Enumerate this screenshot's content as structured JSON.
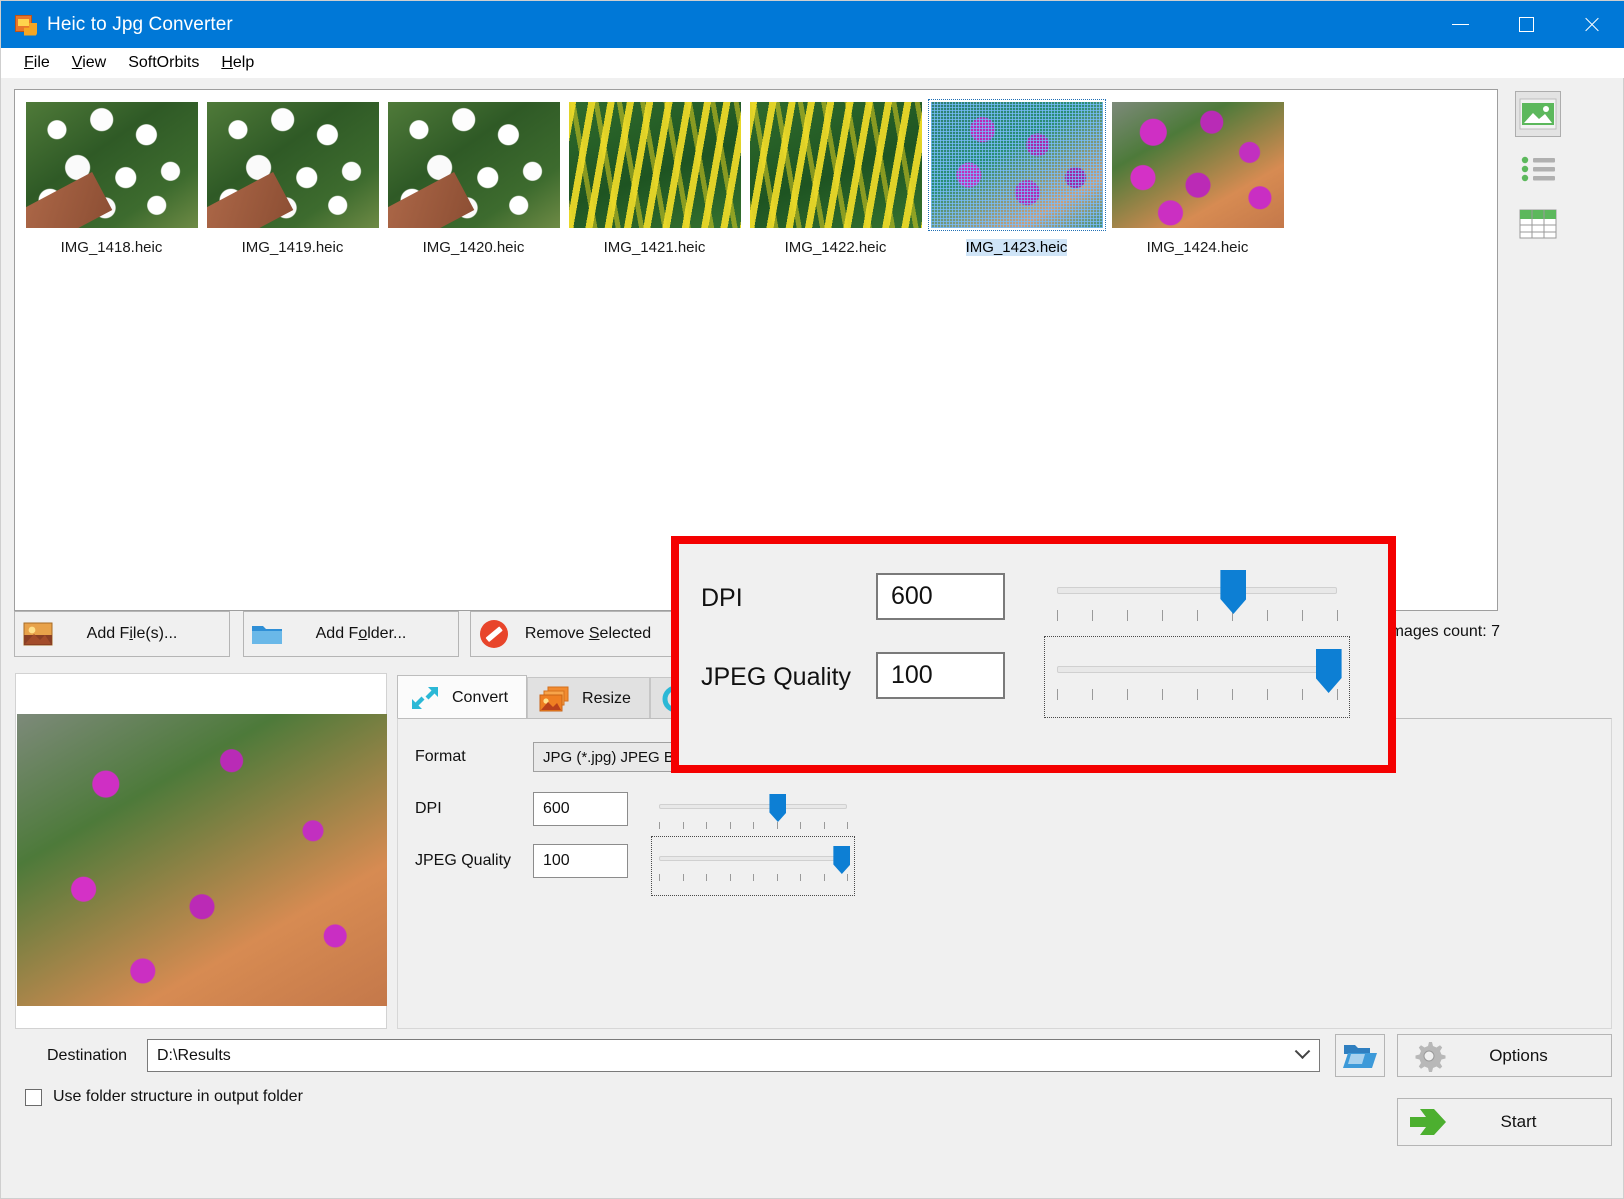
{
  "window": {
    "title": "Heic to Jpg Converter",
    "icon": "app-icon",
    "minimize": "minimize",
    "maximize": "maximize",
    "close": "close"
  },
  "menu": {
    "items": [
      {
        "label": "File",
        "accel": "F"
      },
      {
        "label": "View",
        "accel": "V"
      },
      {
        "label": "SoftOrbits",
        "accel": ""
      },
      {
        "label": "Help",
        "accel": "H"
      }
    ]
  },
  "thumbnails": {
    "items": [
      {
        "label": "IMG_1418.heic",
        "photo": "white-flowers",
        "selected": false
      },
      {
        "label": "IMG_1419.heic",
        "photo": "white-flowers",
        "selected": false
      },
      {
        "label": "IMG_1420.heic",
        "photo": "white-flowers",
        "selected": false
      },
      {
        "label": "IMG_1421.heic",
        "photo": "yellow-flowers",
        "selected": false
      },
      {
        "label": "IMG_1422.heic",
        "photo": "yellow-flowers",
        "selected": false
      },
      {
        "label": "IMG_1423.heic",
        "photo": "purple-flowers",
        "selected": true
      },
      {
        "label": "IMG_1424.heic",
        "photo": "purple-flowers",
        "selected": false
      }
    ]
  },
  "view_modes": [
    {
      "name": "thumbnail-view",
      "icon": "image-icon",
      "active": true
    },
    {
      "name": "list-view",
      "icon": "list-icon",
      "active": false
    },
    {
      "name": "table-view",
      "icon": "table-icon",
      "active": false
    }
  ],
  "actions": {
    "add_files": {
      "label": "Add File(s)...",
      "accel": "i",
      "icon": "add-image-icon"
    },
    "add_folder": {
      "label": "Add Folder...",
      "accel": "o",
      "icon": "folder-icon"
    },
    "remove_selected": {
      "label": "Remove Selected",
      "accel": "S",
      "icon": "remove-icon"
    },
    "images_count": "Images count: 7"
  },
  "tabs": [
    {
      "label": "Convert",
      "icon": "convert-arrows-icon",
      "active": true
    },
    {
      "label": "Resize",
      "icon": "resize-images-icon",
      "active": false
    },
    {
      "label": "",
      "icon": "partial-tab-icon",
      "active": false
    }
  ],
  "form": {
    "format_label": "Format",
    "format_value": "JPG (*.jpg) JPEG B",
    "dpi_label": "DPI",
    "dpi_value": "600",
    "jpeg_label": "JPEG Quality",
    "jpeg_value": "100"
  },
  "callout": {
    "dpi_label": "DPI",
    "dpi_value": "600",
    "jpeg_label": "JPEG Quality",
    "jpeg_value": "100",
    "border_color": "#f40000"
  },
  "sliders": {
    "dpi": {
      "percent": 63,
      "ticks": 9
    },
    "jpeg": {
      "percent": 97,
      "ticks": 9,
      "focused": true
    }
  },
  "destination": {
    "label": "Destination",
    "value": "D:\\Results",
    "browse_icon": "open-folder-icon"
  },
  "checkbox": {
    "label": "Use folder structure in output folder",
    "checked": false
  },
  "buttons": {
    "options": {
      "label": "Options",
      "icon": "gear-icon"
    },
    "start": {
      "label": "Start",
      "icon": "green-arrow-icon"
    }
  },
  "colors": {
    "titlebar": "#0078d7",
    "accent_blue": "#0d7fd4",
    "callout_red": "#f40000",
    "panel": "#f0f0f0"
  }
}
